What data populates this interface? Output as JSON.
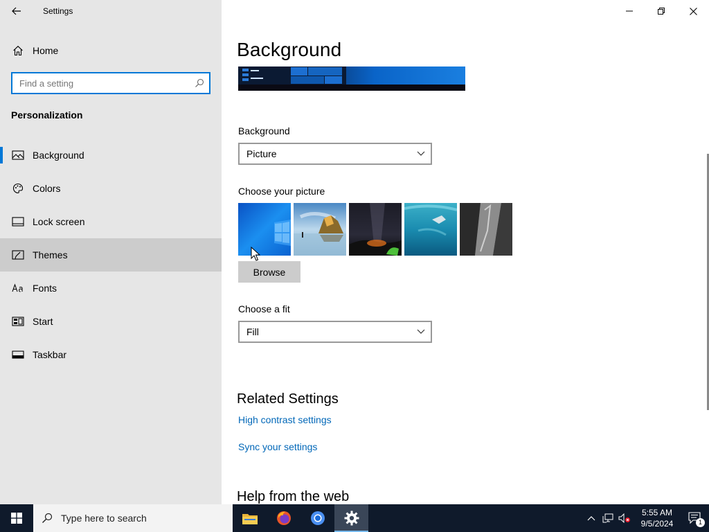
{
  "window": {
    "title": "Settings"
  },
  "sidebar": {
    "home_label": "Home",
    "search_placeholder": "Find a setting",
    "section_title": "Personalization",
    "items": [
      {
        "label": "Background",
        "icon": "picture-icon"
      },
      {
        "label": "Colors",
        "icon": "palette-icon"
      },
      {
        "label": "Lock screen",
        "icon": "lock-screen-icon"
      },
      {
        "label": "Themes",
        "icon": "themes-icon"
      },
      {
        "label": "Fonts",
        "icon": "fonts-icon"
      },
      {
        "label": "Start",
        "icon": "start-icon"
      },
      {
        "label": "Taskbar",
        "icon": "taskbar-icon"
      }
    ]
  },
  "main": {
    "page_title": "Background",
    "background_label": "Background",
    "background_value": "Picture",
    "choose_picture_label": "Choose your picture",
    "browse_label": "Browse",
    "choose_fit_label": "Choose a fit",
    "fit_value": "Fill",
    "related_heading": "Related Settings",
    "links": [
      "High contrast settings",
      "Sync your settings"
    ],
    "help_heading": "Help from the web"
  },
  "taskbar": {
    "search_text": "Type here to search",
    "time": "5:55 AM",
    "date": "9/5/2024",
    "notification_count": "1"
  },
  "colors": {
    "accent": "#0078d7",
    "link": "#0067b8",
    "taskbar": "#0f1a2b"
  }
}
